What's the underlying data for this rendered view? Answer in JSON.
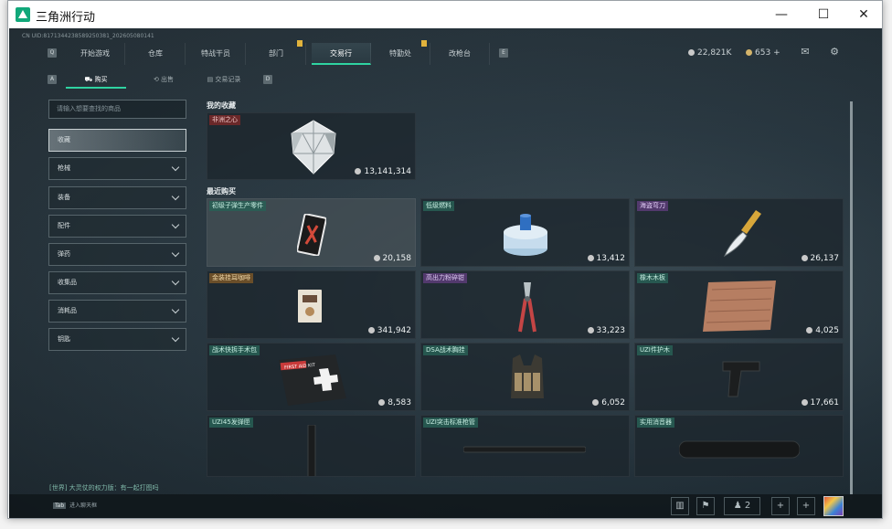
{
  "window": {
    "title": "三角洲行动",
    "minimize": "—",
    "maximize": "☐",
    "close": "✕"
  },
  "build_id": "CN UID:8171344238589250381_202605080141",
  "topnav": {
    "left_key": "Q",
    "right_key": "E",
    "tabs": [
      {
        "label": "开始游戏",
        "flag": false
      },
      {
        "label": "仓库",
        "flag": false
      },
      {
        "label": "特战干员",
        "flag": false
      },
      {
        "label": "部门",
        "flag": true
      },
      {
        "label": "交易行",
        "flag": false,
        "active": true
      },
      {
        "label": "特勤处",
        "flag": true
      },
      {
        "label": "改枪台",
        "flag": false
      }
    ]
  },
  "currency": {
    "silver": "22,821K",
    "gold": "653",
    "plus": "+"
  },
  "hud": {
    "mail_icon": "mail-icon",
    "settings_icon": "gear-icon"
  },
  "subtabs": {
    "left_key": "A",
    "right_key": "D",
    "items": [
      {
        "label": "购买",
        "icon": "cart-icon",
        "active": true
      },
      {
        "label": "出售",
        "icon": "sell-icon"
      },
      {
        "label": "交易记录",
        "icon": "record-icon"
      }
    ]
  },
  "search": {
    "placeholder": "请输入想要查找的商品"
  },
  "categories": [
    {
      "label": "收藏",
      "active": true,
      "expandable": false
    },
    {
      "label": "枪械",
      "expandable": true
    },
    {
      "label": "装备",
      "expandable": true
    },
    {
      "label": "配件",
      "expandable": true
    },
    {
      "label": "弹药",
      "expandable": true
    },
    {
      "label": "收集品",
      "expandable": true
    },
    {
      "label": "消耗品",
      "expandable": true
    },
    {
      "label": "钥匙",
      "expandable": true
    }
  ],
  "favorites": {
    "title": "我的收藏",
    "items": [
      {
        "name": "非洲之心",
        "price": "13,141,314",
        "tag_color": "red",
        "art": "diamond"
      }
    ]
  },
  "recent": {
    "title": "最近购买",
    "items": [
      {
        "name": "初级子弹生产零件",
        "price": "20,158",
        "tag_color": "teal",
        "art": "card-item",
        "highlight": true
      },
      {
        "name": "低级燃料",
        "price": "13,412",
        "tag_color": "teal",
        "art": "fuel"
      },
      {
        "name": "海盗弯刀",
        "price": "26,137",
        "tag_color": "purple",
        "art": "knife"
      },
      {
        "name": "金装挂耳咖啡",
        "price": "341,942",
        "tag_color": "gold",
        "art": "coffee"
      },
      {
        "name": "高出力粉碎钳",
        "price": "33,223",
        "tag_color": "purple",
        "art": "pliers"
      },
      {
        "name": "橡木木板",
        "price": "4,025",
        "tag_color": "teal",
        "art": "plank"
      },
      {
        "name": "战术快拆手术包",
        "price": "8,583",
        "tag_color": "teal",
        "art": "medkit"
      },
      {
        "name": "DSA战术胸挂",
        "price": "6,052",
        "tag_color": "teal",
        "art": "vest"
      },
      {
        "name": "UZI件护木",
        "price": "17,661",
        "tag_color": "teal",
        "art": "grip"
      },
      {
        "name": "UZI45发弹匣",
        "price": "",
        "tag_color": "teal",
        "art": "mag"
      },
      {
        "name": "UZI突击标准枪管",
        "price": "",
        "tag_color": "teal",
        "art": "barrel"
      },
      {
        "name": "实用消音器",
        "price": "",
        "tag_color": "teal",
        "art": "silencer"
      }
    ]
  },
  "medkit_text": "FIRST AID KIT",
  "chat": "[世界] 大灵仗的权力版：有一起打图吗",
  "bottom": {
    "key": "Tab",
    "key_label": "进入聊天框",
    "friends_count": "2",
    "plus": "+"
  },
  "colors": {
    "accent": "#2fd3a1",
    "flag": "#e2b33c"
  }
}
